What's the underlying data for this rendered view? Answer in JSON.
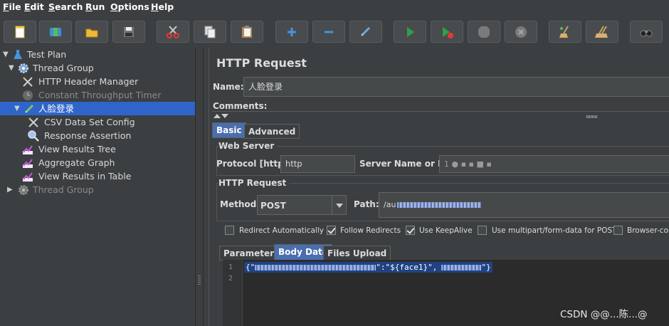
{
  "menu": {
    "items": [
      {
        "mnemonic": "F",
        "rest": "ile"
      },
      {
        "mnemonic": "E",
        "rest": "dit"
      },
      {
        "mnemonic": "S",
        "rest": "earch"
      },
      {
        "mnemonic": "R",
        "rest": "un"
      },
      {
        "mnemonic": "O",
        "rest": "ptions"
      },
      {
        "mnemonic": "H",
        "rest": "elp"
      }
    ]
  },
  "toolbar": {
    "buttons": [
      "new-icon",
      "templates-icon",
      "open-icon",
      "save-icon",
      "cut-icon",
      "copy-icon",
      "paste-icon",
      "expand-icon",
      "collapse-icon",
      "toggle-icon",
      "start-icon",
      "start-no-pauses-icon",
      "stop-icon",
      "shutdown-icon",
      "clear-icon",
      "clear-all-icon",
      "search-icon"
    ]
  },
  "tree": {
    "items": [
      {
        "label": "Test Plan",
        "icon": "test-plan-icon",
        "expander": "▼",
        "dim": false
      },
      {
        "label": "Thread Group",
        "icon": "thread-group-icon",
        "expander": "▼",
        "dim": false
      },
      {
        "label": "HTTP Header Manager",
        "icon": "config-tool-icon",
        "expander": "",
        "dim": false
      },
      {
        "label": "Constant Throughput Timer",
        "icon": "timer-icon",
        "expander": "",
        "dim": true
      },
      {
        "label": "人脸登录",
        "icon": "sampler-icon",
        "expander": "▼",
        "dim": false,
        "selected": true
      },
      {
        "label": "CSV Data Set Config",
        "icon": "config-tool-icon",
        "expander": "",
        "dim": false
      },
      {
        "label": "Response Assertion",
        "icon": "assertion-icon",
        "expander": "",
        "dim": false
      },
      {
        "label": "View Results Tree",
        "icon": "listener-icon",
        "expander": "",
        "dim": false
      },
      {
        "label": "Aggregate Graph",
        "icon": "listener-icon",
        "expander": "",
        "dim": false
      },
      {
        "label": "View Results in Table",
        "icon": "listener-icon",
        "expander": "",
        "dim": false
      },
      {
        "label": "Thread Group",
        "icon": "thread-group-icon",
        "expander": "▶",
        "dim": true
      }
    ]
  },
  "sampler": {
    "title": "HTTP Request",
    "name_label": "Name:",
    "name_value": "人脸登录",
    "comments_label": "Comments:",
    "tabs": [
      {
        "label": "Basic",
        "active": true
      },
      {
        "label": "Advanced",
        "active": false
      }
    ],
    "web_server": {
      "title": "Web Server",
      "protocol_label": "Protocol [http]:",
      "protocol_value": "http",
      "server_label": "Server Name or IP:",
      "server_value": "1 ● ▪ ▪ ■ ▪"
    },
    "http_request": {
      "title": "HTTP Request",
      "method_label": "Method:",
      "method_value": "POST",
      "path_label": "Path:",
      "path_value": "/au"
    },
    "checkboxes": [
      {
        "label": "Redirect Automatically",
        "checked": false
      },
      {
        "label": "Follow Redirects",
        "checked": true
      },
      {
        "label": "Use KeepAlive",
        "checked": true
      },
      {
        "label": "Use multipart/form-data for POST",
        "checked": false
      },
      {
        "label": "Browser-com",
        "checked": false
      }
    ],
    "body_tabs": [
      {
        "label": "Parameters",
        "active": false
      },
      {
        "label": "Body Data",
        "active": true
      },
      {
        "label": "Files Upload",
        "active": false
      }
    ],
    "body": {
      "line_numbers": [
        "1",
        "2"
      ],
      "code_start": "{\"",
      "code_mid": "\":\"${face1}\",",
      "code_end": "\"}"
    }
  },
  "watermark": "CSDN @@...陈...@",
  "colors": {
    "background": "#3c3f41",
    "selection": "#2f65ca",
    "active_tab": "#4b6eaf",
    "editor_bg": "#2b2b2b",
    "code_highlight": "#214283"
  }
}
